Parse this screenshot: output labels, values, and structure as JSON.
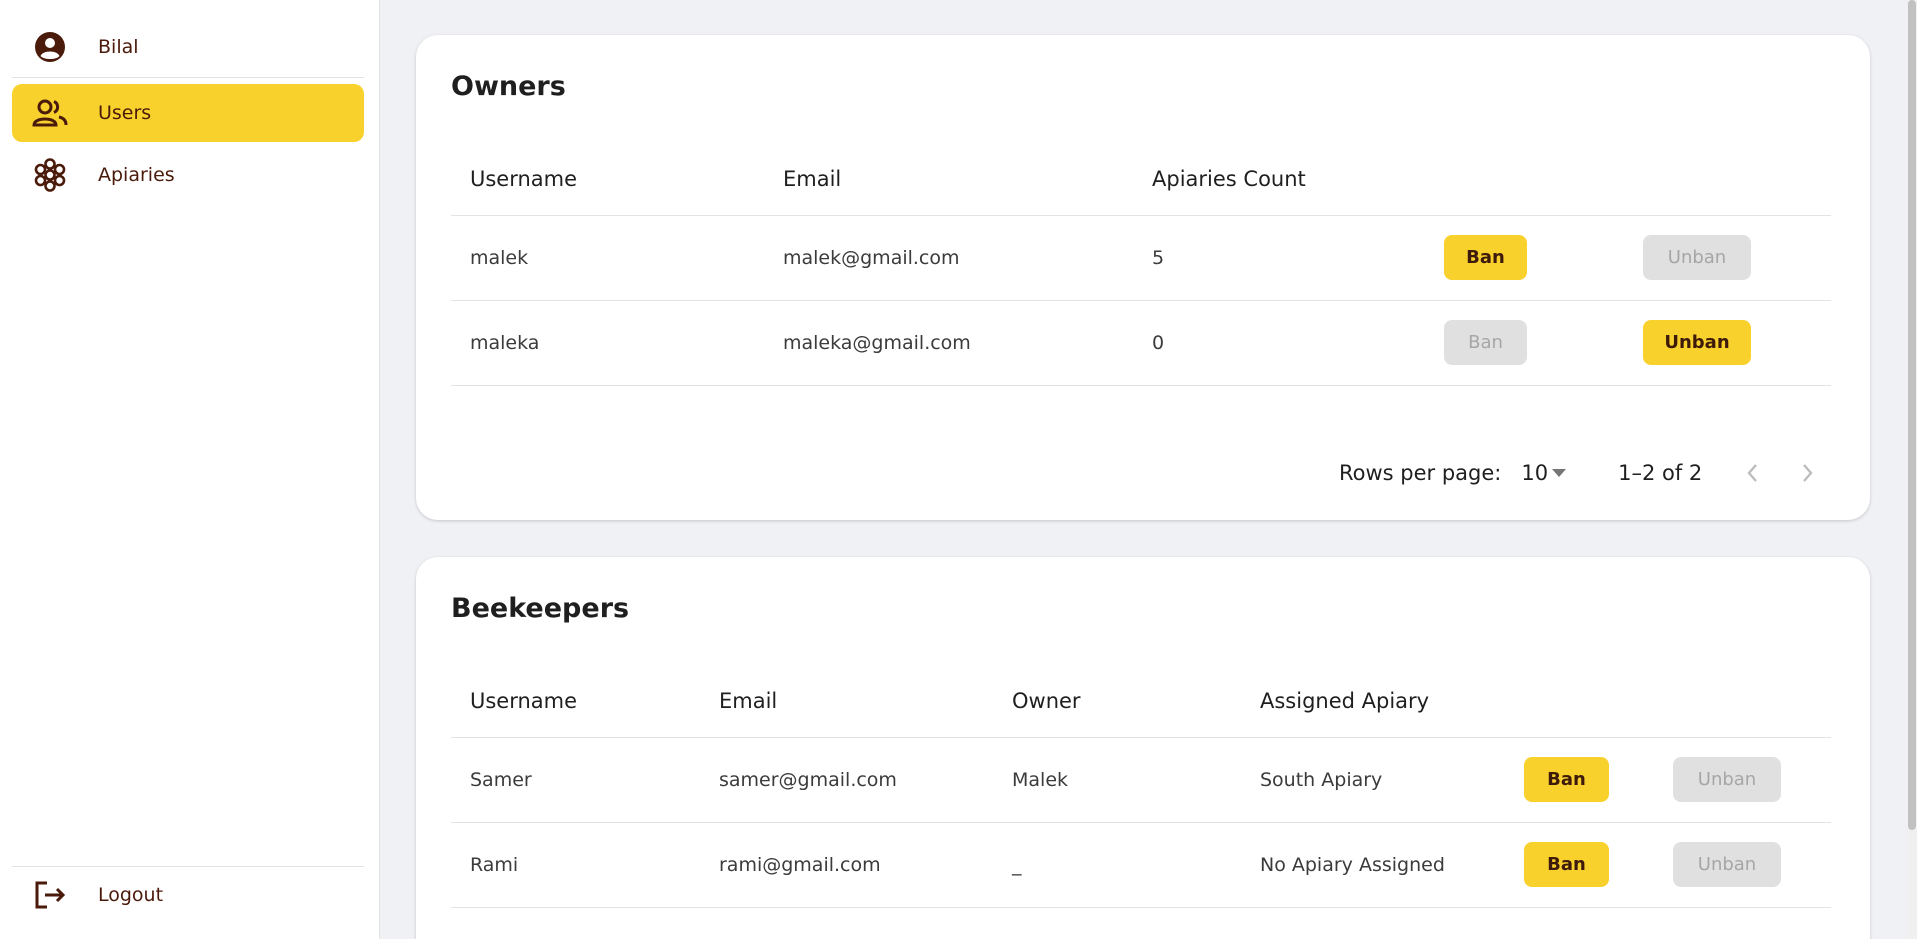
{
  "sidebar": {
    "user_name": "Bilal",
    "items": [
      {
        "label": "Users",
        "icon": "users-icon",
        "active": true
      },
      {
        "label": "Apiaries",
        "icon": "apiary-icon",
        "active": false
      }
    ],
    "logout_label": "Logout"
  },
  "colors": {
    "accent": "#f9d12c",
    "sidebar_text": "#4a1a0a",
    "disabled_bg": "#e0e0e0",
    "disabled_text": "#a6a6a6",
    "page_bg": "#f0f1f5"
  },
  "owners": {
    "title": "Owners",
    "columns": [
      "Username",
      "Email",
      "Apiaries Count"
    ],
    "rows": [
      {
        "username": "malek",
        "email": "malek@gmail.com",
        "count": "5",
        "ban": "Ban",
        "unban": "Unban",
        "banned": false
      },
      {
        "username": "maleka",
        "email": "maleka@gmail.com",
        "count": "0",
        "ban": "Ban",
        "unban": "Unban",
        "banned": true
      }
    ],
    "pagination": {
      "rows_per_page_label": "Rows per page:",
      "rows_per_page": "10",
      "range": "1–2 of 2"
    }
  },
  "beekeepers": {
    "title": "Beekeepers",
    "columns": [
      "Username",
      "Email",
      "Owner",
      "Assigned Apiary"
    ],
    "rows": [
      {
        "username": "Samer",
        "email": "samer@gmail.com",
        "owner": "Malek",
        "apiary": "South Apiary",
        "ban": "Ban",
        "unban": "Unban",
        "banned": false
      },
      {
        "username": "Rami",
        "email": "rami@gmail.com",
        "owner": "_",
        "apiary": "No Apiary Assigned",
        "ban": "Ban",
        "unban": "Unban",
        "banned": false
      }
    ]
  }
}
